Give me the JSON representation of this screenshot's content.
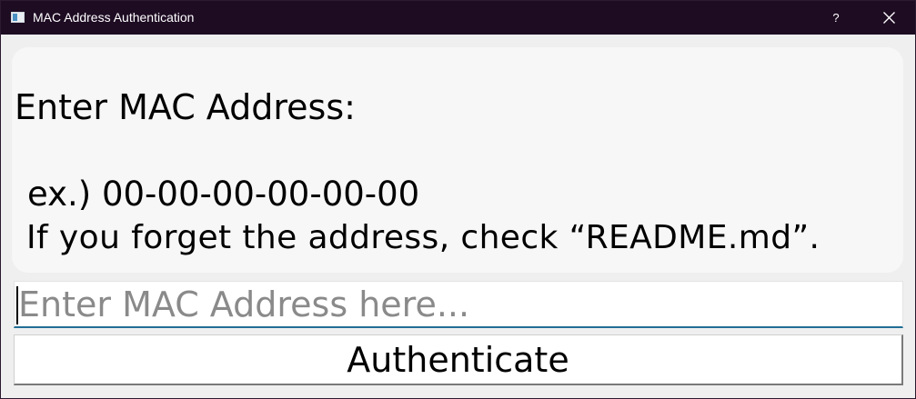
{
  "window": {
    "title": "MAC Address Authentication",
    "help_label": "?",
    "icons": {
      "app": "window-app-icon",
      "close": "close-icon"
    },
    "colors": {
      "titlebar": "#1e0c23",
      "input_focus": "#1f6e95"
    }
  },
  "info": {
    "heading": "Enter MAC Address:",
    "example": "ex.) 00-00-00-00-00-00",
    "hint": "If you forget the address, check “README.md”."
  },
  "mac_input": {
    "value": "",
    "placeholder": "Enter MAC Address here..."
  },
  "actions": {
    "authenticate_label": "Authenticate"
  }
}
